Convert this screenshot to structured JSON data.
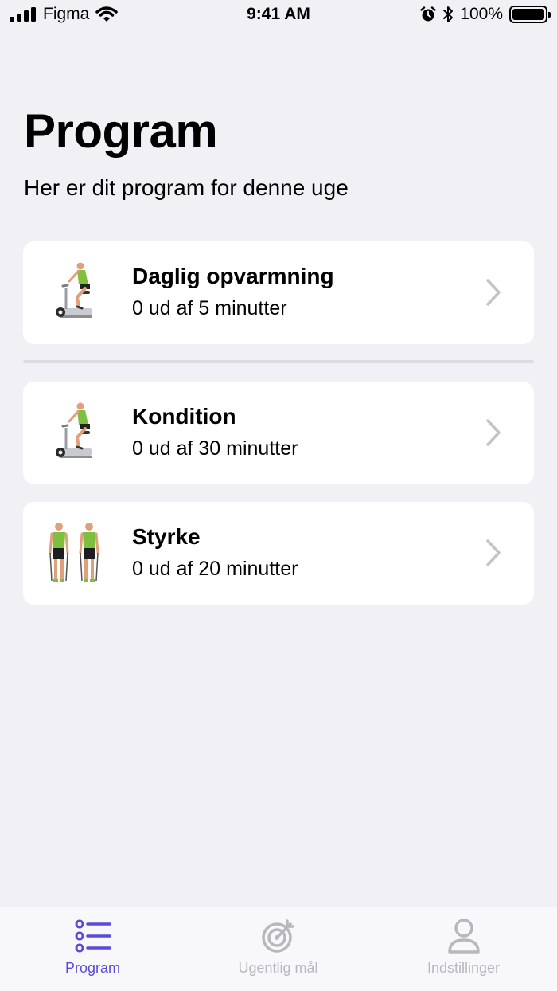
{
  "status_bar": {
    "carrier": "Figma",
    "time": "9:41 AM",
    "battery": "100%"
  },
  "header": {
    "title": "Program",
    "subtitle": "Her er dit program for denne uge"
  },
  "cards": [
    {
      "title": "Daglig opvarmning",
      "subtitle": "0 ud af 5 minutter",
      "icon": "exercise-bike-icon"
    },
    {
      "title": "Kondition",
      "subtitle": "0 ud af 30 minutter",
      "icon": "exercise-bike-icon"
    },
    {
      "title": "Styrke",
      "subtitle": "0 ud af 20 minutter",
      "icon": "resistance-band-icon"
    }
  ],
  "tab_bar": {
    "tabs": [
      {
        "label": "Program",
        "icon": "list-icon",
        "active": true
      },
      {
        "label": "Ugentlig mål",
        "icon": "target-icon",
        "active": false
      },
      {
        "label": "Indstillinger",
        "icon": "person-icon",
        "active": false
      }
    ]
  },
  "colors": {
    "accent": "#5a4cd6",
    "background": "#f1f0f5",
    "card": "#ffffff",
    "inactive_tab": "#b7b7bd",
    "chevron": "#c4c4c7",
    "figure_shirt": "#7fbf3f"
  }
}
